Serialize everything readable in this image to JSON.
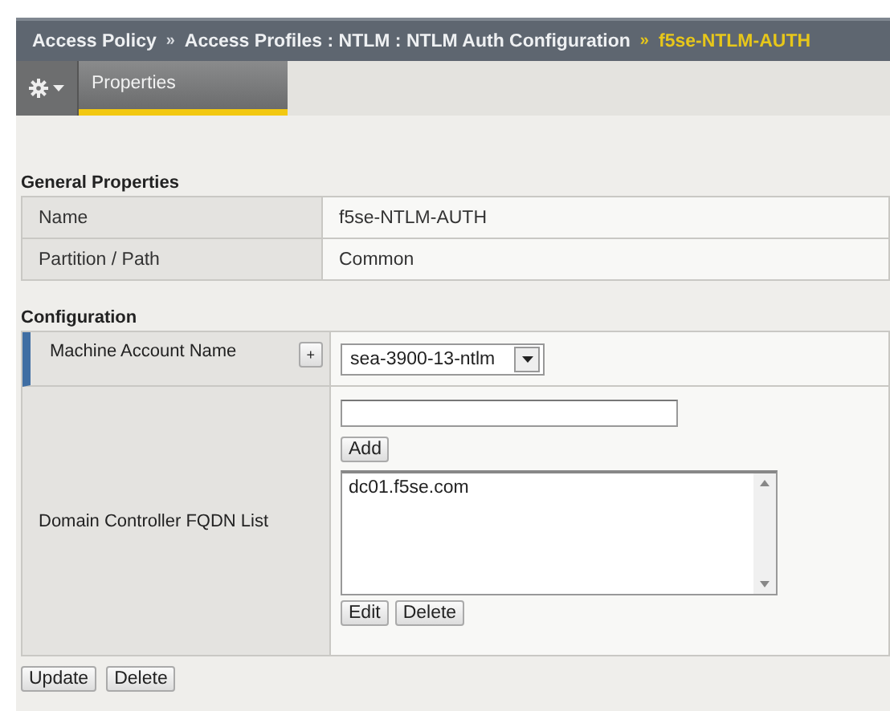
{
  "breadcrumb": [
    {
      "label": "Access Policy",
      "current": false
    },
    {
      "label": "Access Profiles : NTLM : NTLM Auth Configuration",
      "current": false
    },
    {
      "label": "f5se-NTLM-AUTH",
      "current": true
    }
  ],
  "separator": "»",
  "tabs": [
    {
      "label": "Properties",
      "selected": true
    }
  ],
  "general": {
    "title": "General Properties",
    "rows": [
      {
        "label": "Name",
        "value": "f5se-NTLM-AUTH"
      },
      {
        "label": "Partition / Path",
        "value": "Common"
      }
    ]
  },
  "configuration": {
    "title": "Configuration",
    "machine_account": {
      "label": "Machine Account Name",
      "plus": "+",
      "value": "sea-3900-13-ntlm"
    },
    "fqdn": {
      "label": "Domain Controller FQDN List",
      "add_button": "Add",
      "items": [
        "dc01.f5se.com"
      ],
      "edit_button": "Edit",
      "delete_button": "Delete"
    }
  },
  "actions": [
    "Update",
    "Delete"
  ]
}
